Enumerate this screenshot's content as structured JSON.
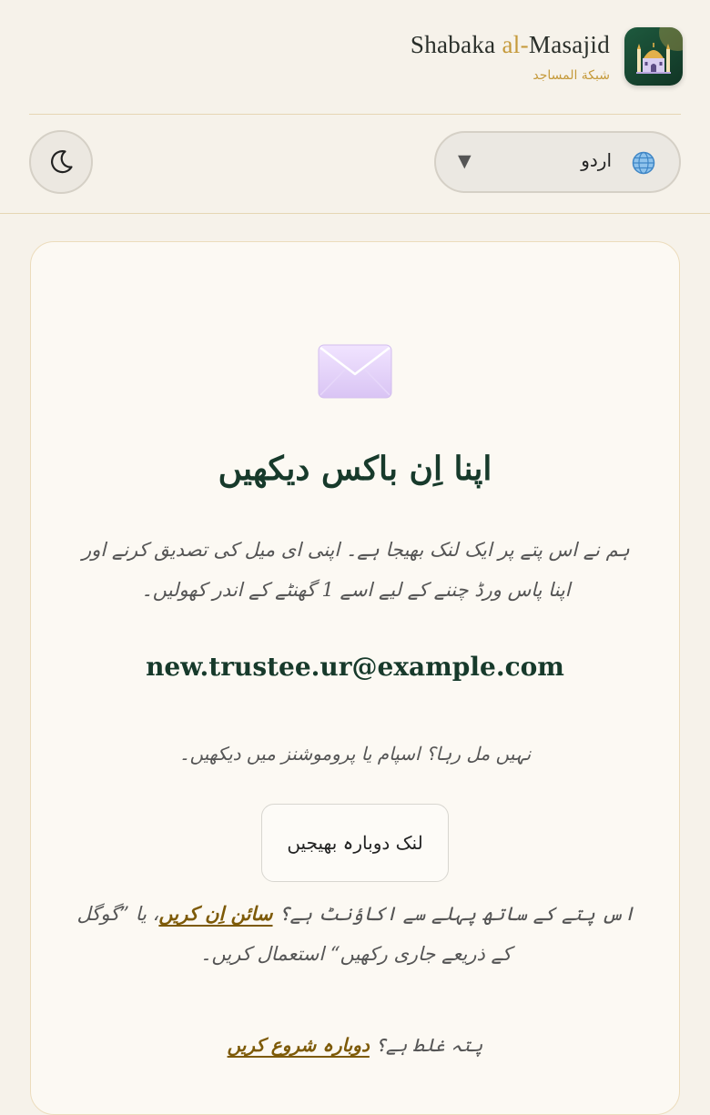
{
  "brand": {
    "title_prefix": "Shabaka ",
    "title_accent": "al-",
    "title_suffix": "Masajid",
    "subtitle": "شبكة المساجد",
    "logo_icon": "mosque-icon"
  },
  "controls": {
    "theme_icon": "moon-icon",
    "language": {
      "selected": "اردو",
      "icon": "globe-icon",
      "caret": "▼"
    }
  },
  "card": {
    "icon": "envelope-icon",
    "title": "اپنا اِن باکس دیکھیں",
    "body": "ہم نے اس پتے پر ایک لنک بھیجا ہے۔ اپنی ای میل کی تصدیق کرنے اور اپنا پاس ورڈ چننے کے لیے اسے 1 گھنٹے کے اندر کھولیں۔",
    "email": "new.trustee.ur@example.com",
    "hint": "نہیں مل رہا؟ اسپام یا پروموشنز میں دیکھیں۔",
    "resend_label": "لنک دوبارہ بھیجیں",
    "account_prefix": "اس پتے کے ساتھ پہلے سے اکاؤنٹ ہے؟ ",
    "account_link": "سائن اِن کریں",
    "account_suffix": "، یا ”گوگل کے ذریعے جاری رکھیں“ استعمال کریں۔",
    "restart_prefix": "پتہ غلط ہے؟ ",
    "restart_link": "دوبارہ شروع کریں"
  },
  "colors": {
    "background": "#f6f2ea",
    "accent_gold": "#c59a3b",
    "title_green": "#173a2b",
    "link_brown": "#7d5a07"
  }
}
